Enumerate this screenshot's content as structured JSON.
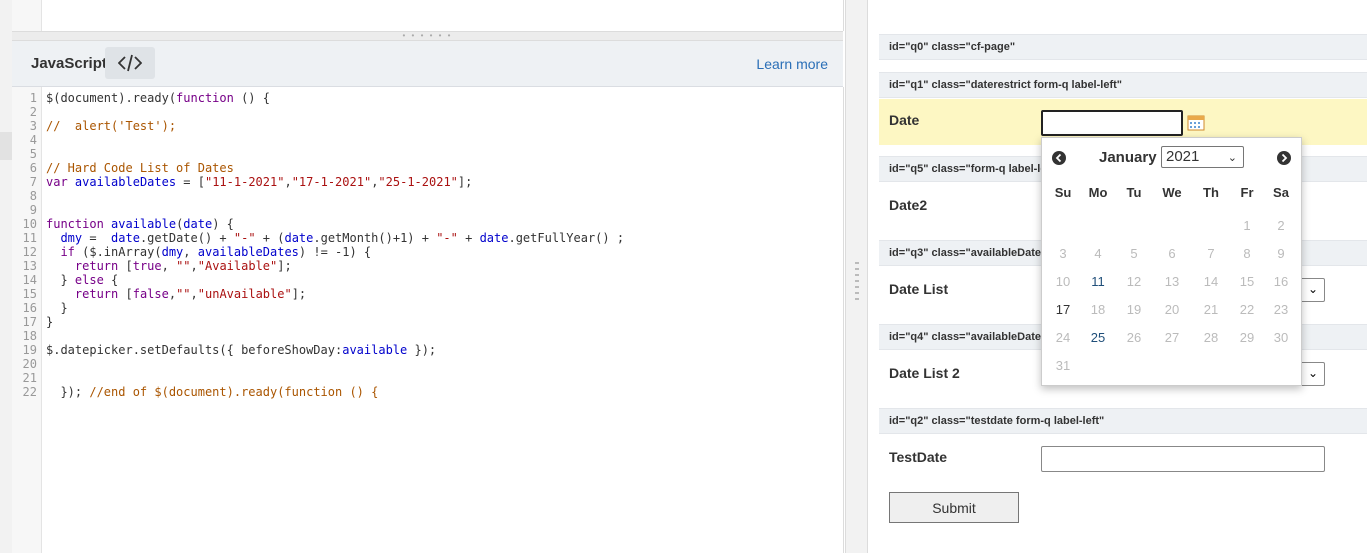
{
  "left_panel": {
    "js_title": "JavaScript",
    "code_toggle_icon": "code-brackets-icon",
    "learn_more": "Learn more",
    "code_lines": [
      {
        "n": "1",
        "t": "$(document).ready(function () {"
      },
      {
        "n": "2",
        "t": ""
      },
      {
        "n": "3",
        "t": "//  alert('Test');"
      },
      {
        "n": "4",
        "t": ""
      },
      {
        "n": "5",
        "t": ""
      },
      {
        "n": "6",
        "t": "// Hard Code List of Dates"
      },
      {
        "n": "7",
        "t": "var availableDates = [\"11-1-2021\",\"17-1-2021\",\"25-1-2021\"];"
      },
      {
        "n": "8",
        "t": ""
      },
      {
        "n": "9",
        "t": ""
      },
      {
        "n": "10",
        "t": "function available(date) {"
      },
      {
        "n": "11",
        "t": "  dmy =  date.getDate() + \"-\" + (date.getMonth()+1) + \"-\" + date.getFullYear() ;"
      },
      {
        "n": "12",
        "t": "  if ($.inArray(dmy, availableDates) != -1) {"
      },
      {
        "n": "13",
        "t": "    return [true, \"\",\"Available\"];"
      },
      {
        "n": "14",
        "t": "  } else {"
      },
      {
        "n": "15",
        "t": "    return [false,\"\",\"unAvailable\"];"
      },
      {
        "n": "16",
        "t": "  }"
      },
      {
        "n": "17",
        "t": "}"
      },
      {
        "n": "18",
        "t": ""
      },
      {
        "n": "19",
        "t": "$.datepicker.setDefaults({ beforeShowDay:available });"
      },
      {
        "n": "20",
        "t": ""
      },
      {
        "n": "21",
        "t": ""
      },
      {
        "n": "22",
        "t": "  }); //end of $(document).ready(function () {"
      }
    ]
  },
  "right_panel": {
    "q0_meta": {
      "id": "id=\"q0\"",
      "cls": "class=\"cf-page\""
    },
    "q1_meta": {
      "id": "id=\"q1\"",
      "cls": "class=\"daterestrict form-q label-left\""
    },
    "q1_label": "Date",
    "q5_meta": {
      "id": "id=\"q5\"",
      "cls": "class=\"form-q label-left\""
    },
    "q5_label": "Date2",
    "q3_meta": {
      "id": "id=\"q3\"",
      "cls": "class=\"availableDates"
    },
    "q3_label": "Date List",
    "q4_meta": {
      "id": "id=\"q4\"",
      "cls": "class=\"availableDates"
    },
    "q4_label": "Date List 2",
    "q2_meta": {
      "id": "id=\"q2\"",
      "cls": "class=\"testdate form-q label-left\""
    },
    "q2_label": "TestDate",
    "submit_label": "Submit",
    "calendar_icon": "calendar-icon"
  },
  "datepicker": {
    "month": "January",
    "year": "2021",
    "weekdays": [
      "Su",
      "Mo",
      "Tu",
      "We",
      "Th",
      "Fr",
      "Sa"
    ],
    "days": [
      {
        "d": "1",
        "avail": false
      },
      {
        "d": "2",
        "avail": false
      },
      {
        "d": "3",
        "avail": false
      },
      {
        "d": "4",
        "avail": false
      },
      {
        "d": "5",
        "avail": false
      },
      {
        "d": "6",
        "avail": false
      },
      {
        "d": "7",
        "avail": false
      },
      {
        "d": "8",
        "avail": false
      },
      {
        "d": "9",
        "avail": false
      },
      {
        "d": "10",
        "avail": false
      },
      {
        "d": "11",
        "avail": true
      },
      {
        "d": "12",
        "avail": false
      },
      {
        "d": "13",
        "avail": false
      },
      {
        "d": "14",
        "avail": false
      },
      {
        "d": "15",
        "avail": false
      },
      {
        "d": "16",
        "avail": false
      },
      {
        "d": "17",
        "avail": true
      },
      {
        "d": "18",
        "avail": false
      },
      {
        "d": "19",
        "avail": false
      },
      {
        "d": "20",
        "avail": false
      },
      {
        "d": "21",
        "avail": false
      },
      {
        "d": "22",
        "avail": false
      },
      {
        "d": "23",
        "avail": false
      },
      {
        "d": "24",
        "avail": false
      },
      {
        "d": "25",
        "avail": true
      },
      {
        "d": "26",
        "avail": false
      },
      {
        "d": "27",
        "avail": false
      },
      {
        "d": "28",
        "avail": false
      },
      {
        "d": "29",
        "avail": false
      },
      {
        "d": "30",
        "avail": false
      },
      {
        "d": "31",
        "avail": false
      }
    ],
    "first_weekday_index": 5
  }
}
